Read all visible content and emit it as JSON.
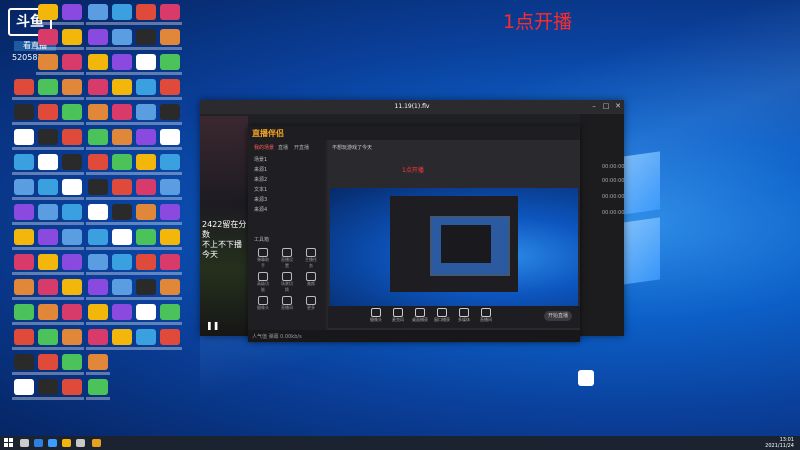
{
  "desktop": {
    "overlay_title": "1点开播",
    "logo": {
      "text": "斗鱼",
      "sub": "看直播",
      "room_id": "520583"
    },
    "app_icon_label": ""
  },
  "main_window": {
    "title": "11.19(1).flv",
    "player_text_line1": "2422留在分数",
    "player_text_line2": "不上不下播今天",
    "right_panel_times": [
      "00:00:00",
      "00:00:00",
      "00:00:00",
      "00:00:00"
    ]
  },
  "obs_window": {
    "app_name": "直播伴侣",
    "tabs": [
      "我的场景",
      "直播",
      "开直播"
    ],
    "scene_title": "不想玩游戏了今天",
    "canvas_title": "1点开播",
    "sidebar_items": [
      "场景1",
      "来源1",
      "来源2",
      "文本1",
      "来源3",
      "来源4"
    ],
    "tools_label": "工具箱",
    "tools": [
      "弹幕助手",
      "直播设置",
      "主播任务",
      "高级功能",
      "场景切换",
      "美颜",
      "摄像头",
      "直播间",
      "更多"
    ],
    "bottom_tools": [
      "摄像头",
      "麦克风",
      "桌面捕获",
      "窗口捕获",
      "多媒体",
      "直播间"
    ],
    "start_button": "开始直播",
    "status": "人气值 弹幕 0.00kb/s"
  },
  "taskbar": {
    "time": "13:01",
    "date": "2021/11/24"
  },
  "colors": {
    "accent_red": "#ff2b2b",
    "desktop_blue": "#0c5fc7"
  }
}
